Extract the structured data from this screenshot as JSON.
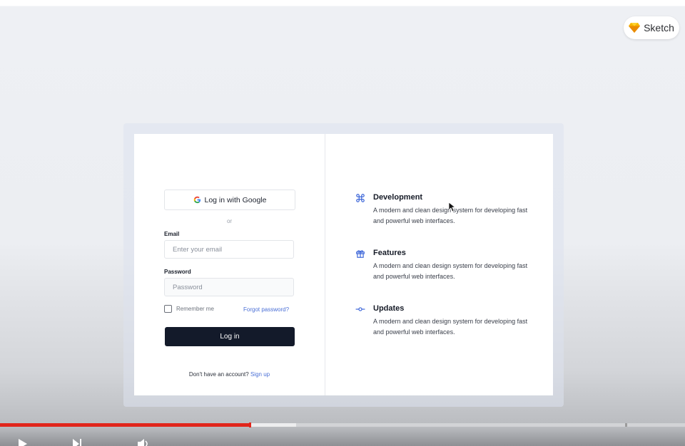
{
  "badge": {
    "label": "Sketch",
    "icon": "sketch-diamond-icon"
  },
  "login": {
    "google_button": "Log in with Google",
    "divider_text": "or",
    "email_label": "Email",
    "email_placeholder": "Enter your email",
    "password_label": "Password",
    "password_placeholder": "Password",
    "remember_label": "Remember me",
    "forgot_link": "Forgot password?",
    "login_button": "Log in",
    "signup_prompt": "Don't have an account?",
    "signup_link": "Sign up"
  },
  "features": [
    {
      "icon": "command-icon",
      "title": "Development",
      "description": "A modern and clean design system for developing fast and powerful web interfaces."
    },
    {
      "icon": "gift-icon",
      "title": "Features",
      "description": "A modern and clean design system for developing fast and powerful web interfaces."
    },
    {
      "icon": "commit-icon",
      "title": "Updates",
      "description": "A modern and clean design system for developing fast and powerful web interfaces."
    }
  ],
  "player": {
    "progress_played": 0.365,
    "progress_buffered": 0.432,
    "colors": {
      "played": "#e1251b",
      "accent_link": "#4a6fd6",
      "button": "#131a2a"
    }
  }
}
